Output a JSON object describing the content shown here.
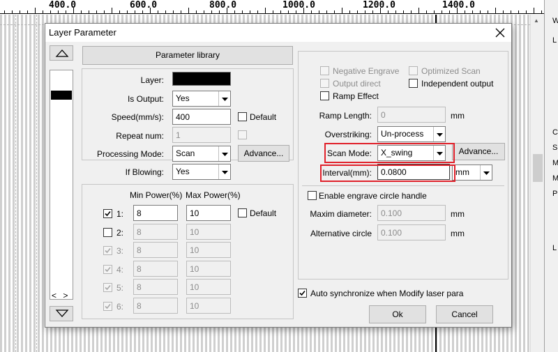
{
  "ruler": {
    "labels": [
      "400.0",
      "600.0",
      "800.0",
      "1000.0",
      "1200.0",
      "1400.0"
    ]
  },
  "right_panel": {
    "fragments": [
      "W",
      "L",
      "C",
      "S",
      "M",
      "M",
      "P",
      "L"
    ]
  },
  "dialog": {
    "title": "Layer Parameter",
    "close_icon": "close-icon",
    "param_library_label": "Parameter library",
    "layer_label": "Layer:",
    "layer_color": "#000000",
    "is_output_label": "Is Output:",
    "is_output_value": "Yes",
    "speed_label": "Speed(mm/s):",
    "speed_value": "400",
    "default_label": "Default",
    "repeat_label": "Repeat num:",
    "repeat_value": "1",
    "proc_mode_label": "Processing Mode:",
    "proc_mode_value": "Scan",
    "advance_label": "Advance...",
    "if_blowing_label": "If Blowing:",
    "if_blowing_value": "Yes",
    "min_power_header": "Min Power(%)",
    "max_power_header": "Max Power(%)",
    "power_default_label": "Default",
    "power_rows": [
      {
        "label": "1:",
        "min": "8",
        "max": "10",
        "checked": true,
        "enabled": true
      },
      {
        "label": "2:",
        "min": "8",
        "max": "10",
        "checked": false,
        "enabled": true
      },
      {
        "label": "3:",
        "min": "8",
        "max": "10",
        "checked": true,
        "enabled": false
      },
      {
        "label": "4:",
        "min": "8",
        "max": "10",
        "checked": true,
        "enabled": false
      },
      {
        "label": "5:",
        "min": "8",
        "max": "10",
        "checked": true,
        "enabled": false
      },
      {
        "label": "6:",
        "min": "8",
        "max": "10",
        "checked": true,
        "enabled": false
      }
    ],
    "nav_arrows": "< >",
    "negative_engrave_label": "Negative Engrave",
    "optimized_scan_label": "Optimized Scan",
    "output_direct_label": "Output direct",
    "independent_output_label": "Independent output",
    "ramp_effect_label": "Ramp Effect",
    "ramp_length_label": "Ramp Length:",
    "ramp_length_value": "0",
    "ramp_length_unit": "mm",
    "overstriking_label": "Overstriking:",
    "overstriking_value": "Un-process",
    "scan_mode_label": "Scan Mode:",
    "scan_mode_value": "X_swing",
    "scan_advance_label": "Advance...",
    "interval_label": "Interval(mm):",
    "interval_value": "0.0800",
    "interval_unit_value": "mm",
    "circle_handle_label": "Enable engrave circle handle",
    "maxim_diameter_label": "Maxim diameter:",
    "maxim_diameter_value": "0.100",
    "maxim_diameter_unit": "mm",
    "alt_circle_label": "Alternative circle",
    "alt_circle_value": "0.100",
    "alt_circle_unit": "mm",
    "auto_sync_label": "Auto synchronize when Modify laser para",
    "ok_label": "Ok",
    "cancel_label": "Cancel"
  },
  "colors": {
    "highlight": "#e0202a",
    "dialog_bg": "#f0f0f0"
  }
}
